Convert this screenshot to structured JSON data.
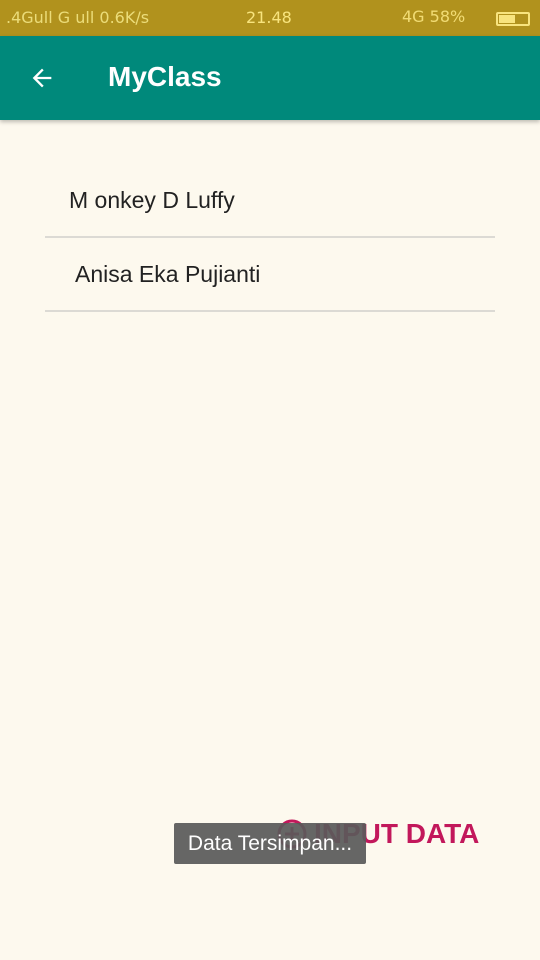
{
  "status_bar": {
    "left_text": ".4Gull G ull 0.6K/s",
    "time": "21.48",
    "right_text": "4G 58%",
    "battery_level": 0.58
  },
  "app_bar": {
    "back_icon": "arrow-back-icon",
    "title": "MyClass"
  },
  "list": {
    "items": [
      {
        "label": "M onkey D Luffy"
      },
      {
        "label": "Anisa Eka Pujianti"
      }
    ]
  },
  "fab": {
    "icon": "add-circle-icon",
    "label": "INPUT DATA",
    "color": "#c2185b"
  },
  "toast": {
    "message": "Data Tersimpan..."
  },
  "colors": {
    "app_bar": "#00897b",
    "background": "#fdf9ee",
    "status_bar": "#b1921d"
  }
}
